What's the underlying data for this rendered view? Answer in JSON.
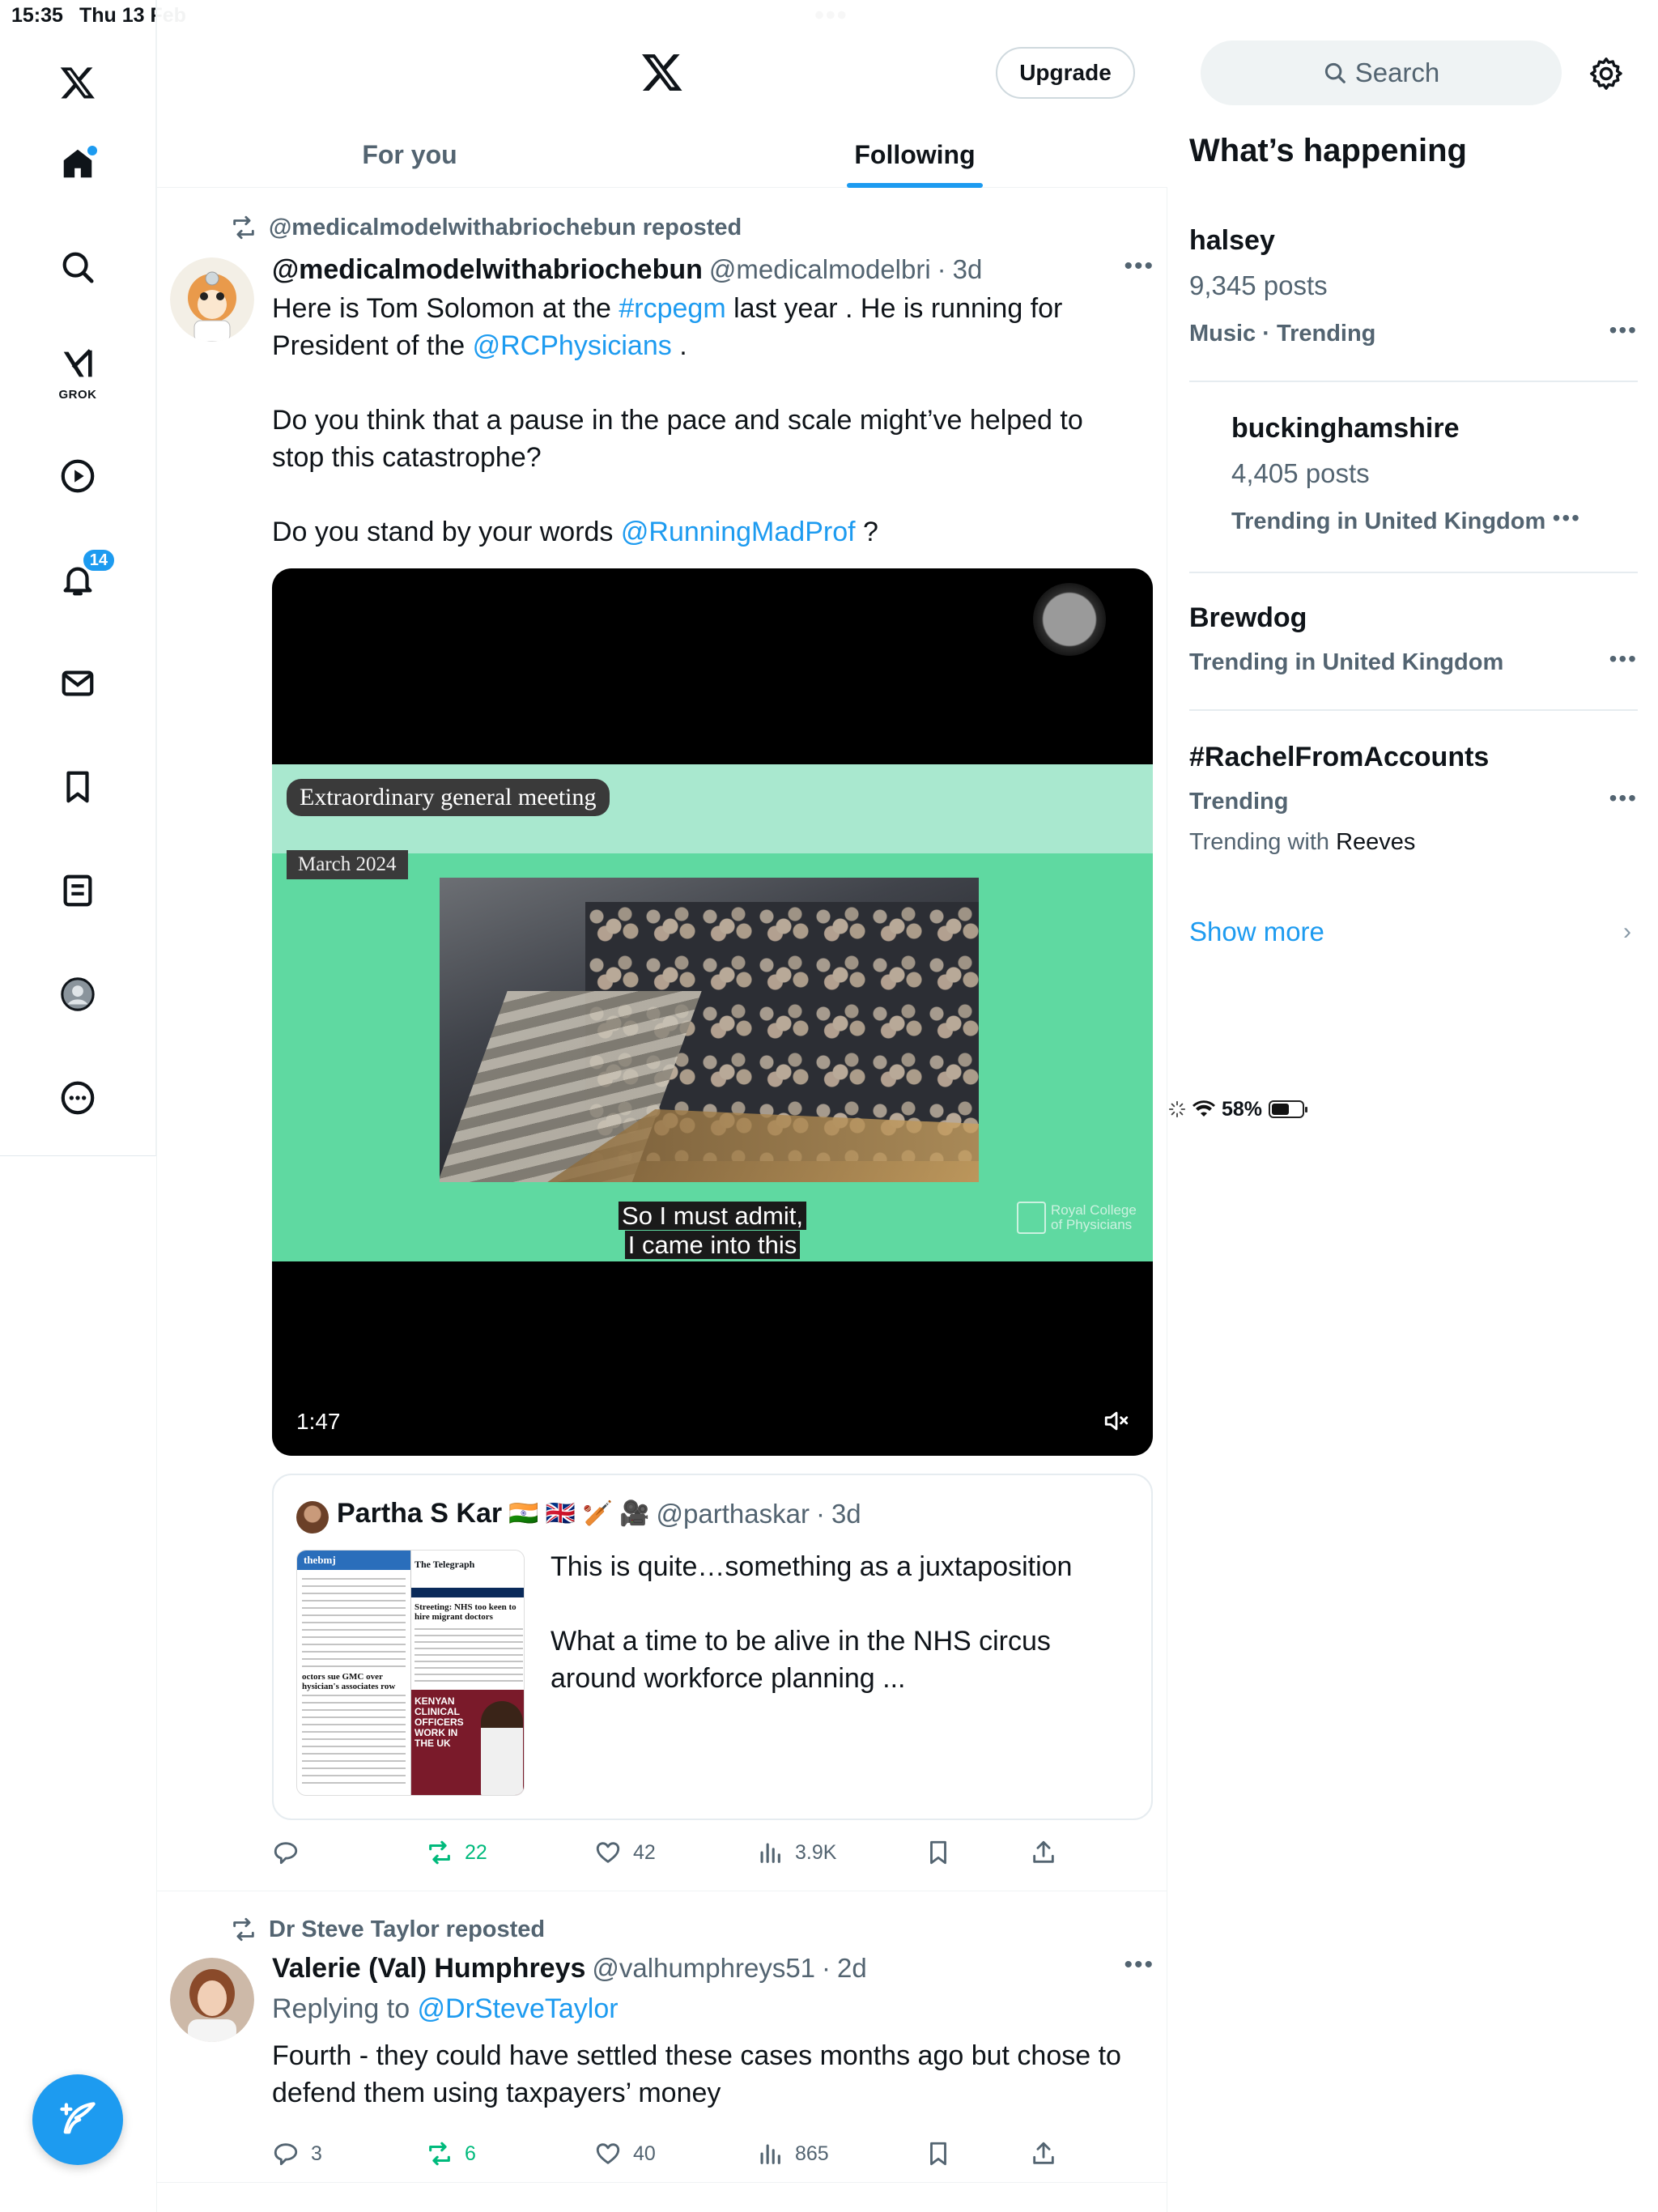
{
  "status_bar": {
    "time": "15:35",
    "date": "Thu 13 Feb",
    "battery": "58%",
    "battery_level": 0.58
  },
  "left_nav": {
    "notifications_badge": "14",
    "grok_label": "GROK",
    "icons": [
      "x-logo-icon",
      "home-icon",
      "search-icon",
      "grok-icon",
      "video-icon",
      "bell-icon",
      "mail-icon",
      "bookmark-icon",
      "lists-icon",
      "profile-icon",
      "more-icon"
    ]
  },
  "header": {
    "upgrade_label": "Upgrade",
    "tabs": [
      {
        "label": "For you",
        "active": false
      },
      {
        "label": "Following",
        "active": true
      }
    ]
  },
  "posts": [
    {
      "reposted_by": "@medicalmodelwithabriochebun reposted",
      "name": "@medicalmodelwithabriochebun",
      "handle": "@medicalmodelbri",
      "separator": "·",
      "time": "3d",
      "text_parts": {
        "p1_a": "Here is Tom Solomon at the ",
        "p1_link1": "#rcpegm",
        "p1_b": " last year . He is running for President of the ",
        "p1_link2": "@RCPhysicians",
        "p1_c": " .",
        "p2": "Do you think that a pause in the pace and scale might’ve helped to stop this catastrophe?",
        "p3_a": "Do you stand by your words ",
        "p3_link": "@RunningMadProf",
        "p3_b": " ?"
      },
      "video": {
        "title": "Extraordinary general meeting",
        "subtitle": "March 2024",
        "caption_line1": "So I must admit,",
        "caption_line2": "I came into this",
        "logo_text_1": "Royal College",
        "logo_text_2": "of Physicians",
        "duration": "1:47"
      },
      "quote": {
        "name": "Partha S Kar",
        "emoji": "🇮🇳 🇬🇧 🏏 🎥",
        "handle": "@parthaskar",
        "separator": "·",
        "time": "3d",
        "text_p1": "This is quite…something as a juxtaposition",
        "text_p2": "What a time to be alive in the NHS circus around workforce planning ...",
        "thumb": {
          "left_brand": "thebmj",
          "left_headline": "octors sue GMC over hysician's associates row",
          "right_brand": "The Telegraph",
          "right_headline": "Streeting: NHS too keen to hire migrant doctors",
          "right_banner": "KENYAN CLINICAL OFFICERS WORK IN THE UK"
        }
      },
      "stats": {
        "replies": "",
        "reposts": "22",
        "likes": "42",
        "views": "3.9K"
      }
    },
    {
      "reposted_by": "Dr Steve Taylor reposted",
      "name": "Valerie (Val) Humphreys",
      "handle": "@valhumphreys51",
      "separator": "·",
      "time": "2d",
      "replying_prefix": "Replying to ",
      "replying_to": "@DrSteveTaylor",
      "text": "Fourth - they could have settled these cases months ago but chose to defend them using taxpayers’ money",
      "stats": {
        "replies": "3",
        "reposts": "6",
        "likes": "40",
        "views": "865"
      }
    }
  ],
  "sidebar": {
    "search_placeholder": "Search",
    "whats_happening": "What’s happening",
    "trends": [
      {
        "title": "halsey",
        "posts": "9,345 posts",
        "category": "Music · Trending"
      },
      {
        "title": "buckinghamshire",
        "posts": "4,405 posts",
        "category": "Trending in United Kingdom"
      },
      {
        "title": "Brewdog",
        "category": "Trending in United Kingdom"
      },
      {
        "title": "#RachelFromAccounts",
        "category": "Trending",
        "with_prefix": "Trending with ",
        "with_name": "Reeves"
      }
    ],
    "show_more": "Show more"
  },
  "colors": {
    "accent": "#1d9bf0",
    "text": "#0f1419",
    "secondary_text": "#536471",
    "repost_green": "#00ba7c",
    "border": "#eff3f4"
  }
}
